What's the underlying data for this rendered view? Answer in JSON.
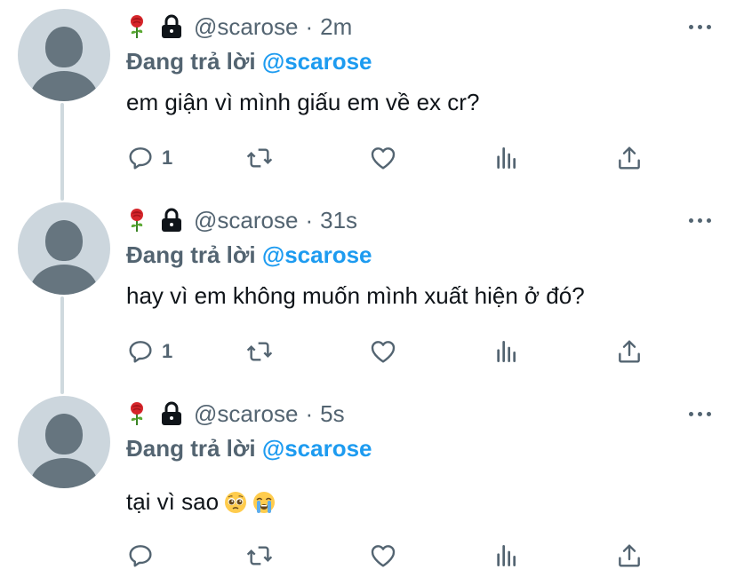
{
  "tweets": [
    {
      "handle": "@scarose",
      "separator": "·",
      "time": "2m",
      "replying_prefix": "Đang trả lời",
      "replying_to": "@scarose",
      "text": "em giận vì mình giấu em về ex cr?",
      "reply_count": "1"
    },
    {
      "handle": "@scarose",
      "separator": "·",
      "time": "31s",
      "replying_prefix": "Đang trả lời",
      "replying_to": "@scarose",
      "text": "hay vì em không muốn mình xuất hiện ở đó?",
      "reply_count": "1"
    },
    {
      "handle": "@scarose",
      "separator": "·",
      "time": "5s",
      "replying_prefix": "Đang trả lời",
      "replying_to": "@scarose",
      "text": "tại vì sao",
      "reply_count": ""
    }
  ],
  "icons": {
    "name_emojis": [
      "rose-icon",
      "lock-icon"
    ],
    "text_emojis": [
      "pleading-face-icon",
      "loudly-crying-face-icon"
    ],
    "actions": [
      "reply-icon",
      "retweet-icon",
      "like-icon",
      "analytics-icon",
      "share-icon"
    ]
  },
  "colors": {
    "mention": "#1d9bf0",
    "secondary_text": "#536471",
    "thread_line": "#cfd9de",
    "avatar_bg": "#ccd6dd",
    "avatar_fg": "#66757f"
  }
}
